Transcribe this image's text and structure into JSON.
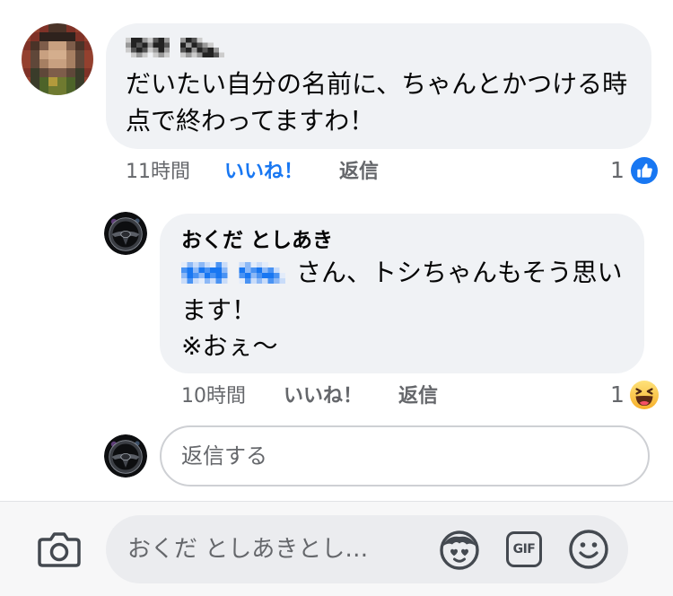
{
  "colors": {
    "page_background": "#ffffff",
    "bubble_background": "#f0f2f5",
    "primary_text": "#050505",
    "secondary_text": "#65676b",
    "liked_accent": "#1877f2",
    "composer_background": "#ebecef"
  },
  "comment": {
    "avatar": "user-avatar",
    "body_lines": [
      "だいたい自分の名前に、ちゃんとかつける時",
      "点で終わってますわ！"
    ],
    "time": "11時間",
    "like_label": "いいね！",
    "liked": true,
    "reply_label": "返信",
    "reaction_count": "1",
    "reaction_icon": "like-reaction-icon"
  },
  "reply": {
    "avatar": "steering-wheel-avatar",
    "author_name": "おくだ としあき",
    "body_lines": [
      "さん、トシちゃんもそう思い",
      "ます！",
      "※おぇ〜"
    ],
    "time": "10時間",
    "like_label": "いいね！",
    "liked": false,
    "reply_label": "返信",
    "reaction_count": "1",
    "reaction_icon": "haha-reaction-icon"
  },
  "reply_box": {
    "avatar": "steering-wheel-avatar",
    "placeholder": "返信する"
  },
  "composer": {
    "camera_icon": "camera-icon",
    "placeholder": "おくだ としあきとし…",
    "avatar_sticker_icon": "avatar-sticker-icon",
    "gif_label": "GIF",
    "emoji_icon": "smiley-icon"
  }
}
